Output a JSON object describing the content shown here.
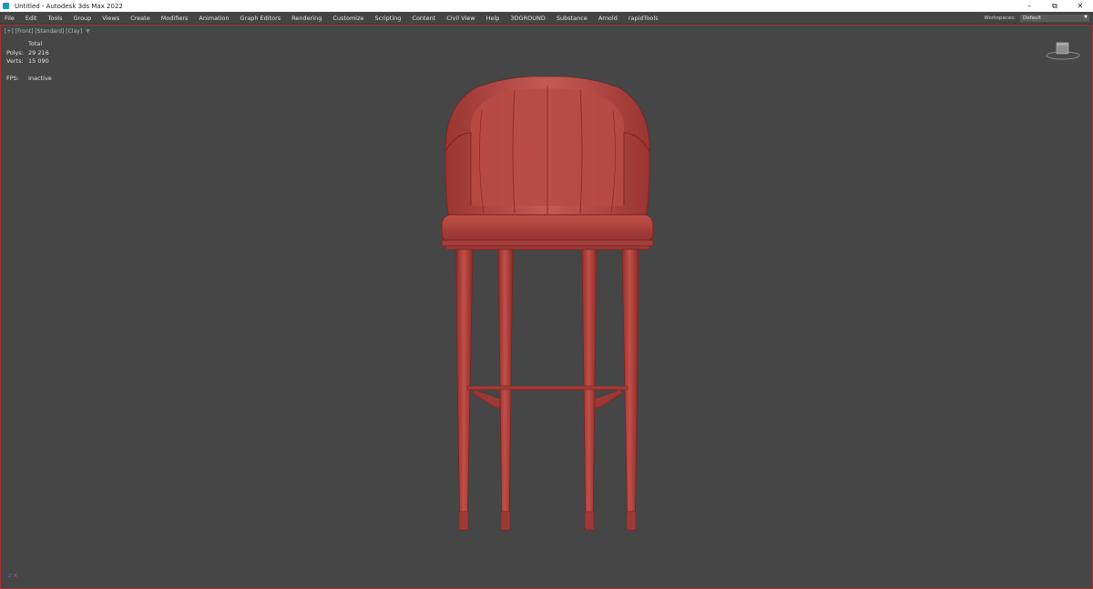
{
  "window": {
    "title": "Untitled - Autodesk 3ds Max 2022",
    "minimize_glyph": "–",
    "maximize_glyph": "⧉",
    "close_glyph": "✕"
  },
  "menu": {
    "items": [
      "File",
      "Edit",
      "Tools",
      "Group",
      "Views",
      "Create",
      "Modifiers",
      "Animation",
      "Graph Editors",
      "Rendering",
      "Customize",
      "Scripting",
      "Content",
      "Civil View",
      "Help",
      "3DGROUND",
      "Substance",
      "Arnold",
      "rapidTools"
    ]
  },
  "workspaces": {
    "label": "Workspaces:",
    "value": "Default",
    "arrow": "▼"
  },
  "viewport": {
    "label": "[+] [Front] [Standard] [Clay]",
    "filter_glyph": "▼",
    "stats": {
      "header": "Total",
      "polys_label": "Polys:",
      "polys_value": "29 216",
      "verts_label": "Verts:",
      "verts_value": "15 090",
      "fps_label": "FPS:",
      "fps_value": "Inactive"
    },
    "axis_z": "z",
    "axis_x": "x"
  },
  "colors": {
    "viewport_bg": "#464646",
    "viewport_border": "#a43232",
    "clay": "#b8443f"
  }
}
